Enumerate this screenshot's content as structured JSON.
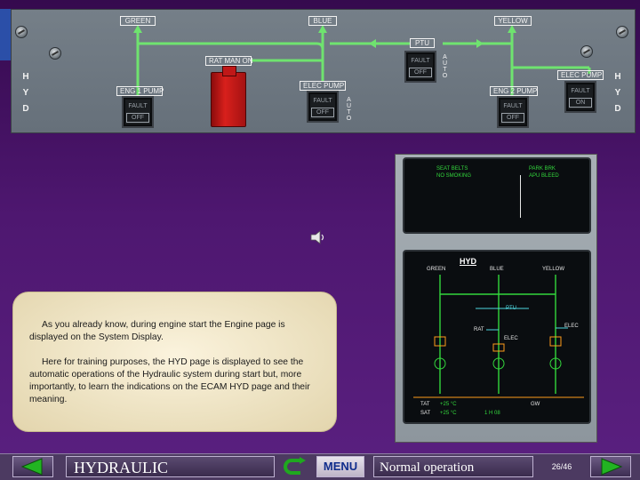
{
  "overhead_panel": {
    "system_boxes": {
      "green": "GREEN",
      "blue": "BLUE",
      "yellow": "YELLOW",
      "ptu": "PTU"
    },
    "side_letters": [
      "H",
      "Y",
      "D"
    ],
    "ratman_label": "RAT MAN ON",
    "pumps": {
      "eng1": {
        "label": "ENG 1 PUMP",
        "top": "FAULT",
        "bottom": "OFF"
      },
      "blue_elec": {
        "label": "ELEC PUMP",
        "top": "FAULT",
        "bottom": "OFF"
      },
      "ptu": {
        "top": "FAULT",
        "bottom": "OFF"
      },
      "eng2": {
        "label": "ENG 2 PUMP",
        "top": "FAULT",
        "bottom": "OFF"
      },
      "yellow_elec": {
        "label": "ELEC PUMP",
        "top": "FAULT",
        "bottom": "ON"
      }
    },
    "auto_text": [
      "A",
      "U",
      "T",
      "O"
    ],
    "auto_blue_text": [
      "A",
      "U",
      "T",
      "O"
    ]
  },
  "ecam": {
    "upper": {
      "left": [
        "SEAT BELTS",
        "NO SMOKING"
      ],
      "right": [
        "PARK BRK",
        "APU BLEED"
      ]
    },
    "lower": {
      "title": "HYD",
      "systems": [
        "GREEN",
        "BLUE",
        "YELLOW"
      ],
      "ptu_label": "PTU",
      "rat_label": "RAT",
      "elec_label": "ELEC",
      "elec_blue": "ELEC",
      "tat_label": "TAT",
      "tat_value": "+25 °C",
      "sat_label": "SAT",
      "sat_value": "+25 °C",
      "time_value": "1 H 08",
      "gw_label": "GW"
    }
  },
  "info_text": {
    "paragraph1": "As you already know, during engine start the Engine page is displayed on the System Display.",
    "paragraph2": "Here for training purposes, the HYD page is displayed to see the automatic operations of the Hydraulic system during start but, more importantly, to learn the indications on the ECAM HYD page and their meaning."
  },
  "bottom_bar": {
    "module_title": "HYDRAULIC",
    "menu_label": "MENU",
    "status": "Normal operation",
    "page_counter": "26/46"
  },
  "icons": {
    "speaker": "speaker-icon",
    "back": "back-arrow-icon",
    "next": "next-arrow-icon",
    "return": "return-icon"
  },
  "colors": {
    "hydraulic_line": "#6fe36f",
    "ecam_green": "#33d63c",
    "ecam_amber": "#ff9c1a",
    "ecam_cyan": "#4fd8e0",
    "menu_text": "#102d8c"
  }
}
